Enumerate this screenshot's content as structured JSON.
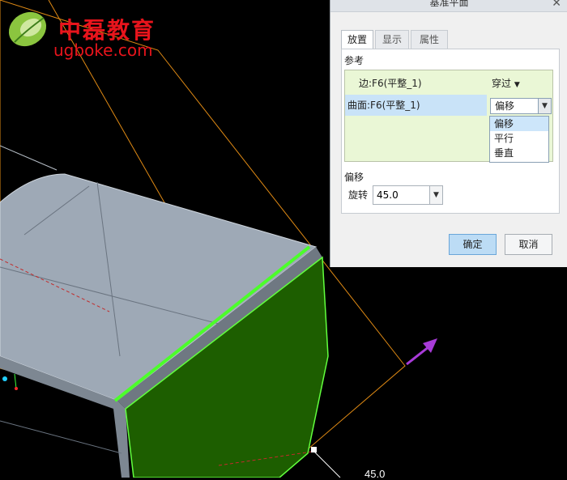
{
  "logo": {
    "chinese": "中磊教育",
    "url": "ugboke.com"
  },
  "viewport": {
    "dimension_label": "45.0"
  },
  "dialog": {
    "title": "基准平面",
    "tabs": [
      {
        "label": "放置",
        "active": true
      },
      {
        "label": "显示",
        "active": false
      },
      {
        "label": "属性",
        "active": false
      }
    ],
    "references_label": "参考",
    "references": [
      {
        "name": "边:F6(平整_1)",
        "type": "穿过"
      },
      {
        "name": "曲面:F6(平整_1)",
        "type": "偏移"
      }
    ],
    "dropdown_options": [
      "偏移",
      "平行",
      "垂直"
    ],
    "offset_label": "偏移",
    "rotation_label": "旋转",
    "rotation_value": "45.0",
    "ok_label": "确定",
    "cancel_label": "取消"
  },
  "colors": {
    "accent": "#e8141c",
    "face_green": "#1f5c00",
    "edge_green": "#5aff3a",
    "surface": "#9aa6b4",
    "arrow": "#a83bd8"
  }
}
